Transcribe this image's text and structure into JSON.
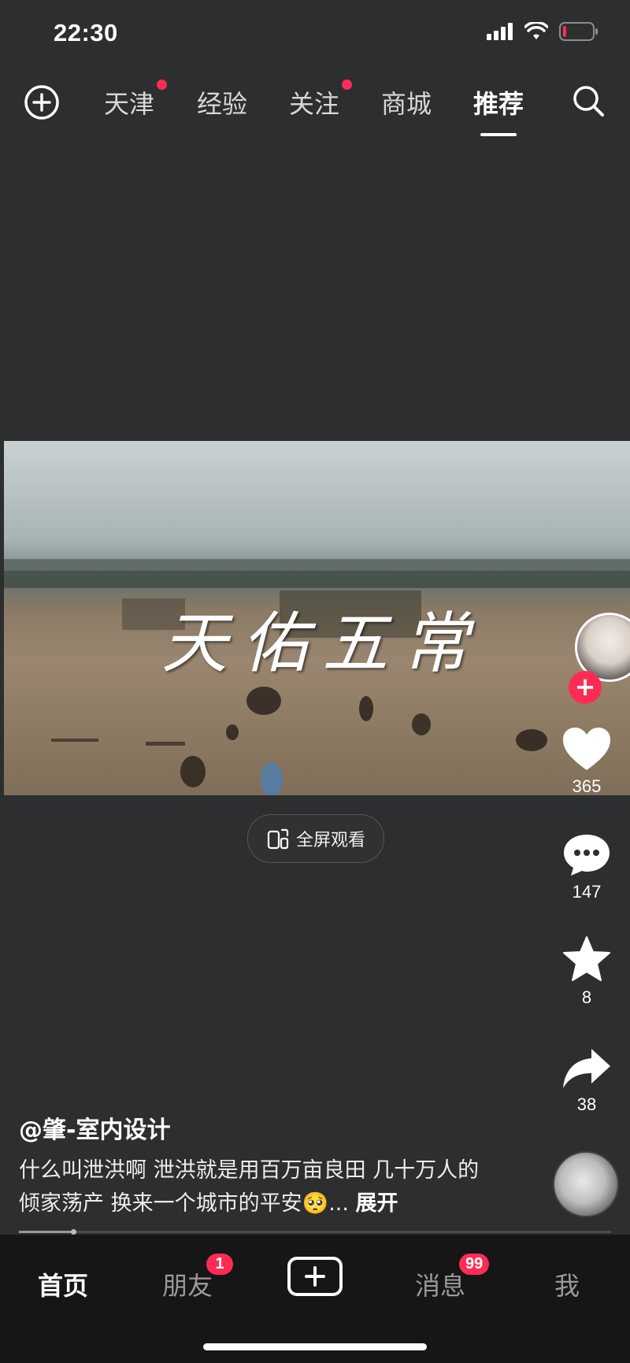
{
  "status_bar": {
    "time": "22:30"
  },
  "top_nav": {
    "tabs": [
      {
        "label": "天津",
        "dot": true
      },
      {
        "label": "经验",
        "dot": false
      },
      {
        "label": "关注",
        "dot": true
      },
      {
        "label": "商城",
        "dot": false
      },
      {
        "label": "推荐",
        "dot": false,
        "active": true
      }
    ]
  },
  "video": {
    "overlay_title": "天佑五常"
  },
  "fullscreen_label": "全屏观看",
  "actions": {
    "likes": "365",
    "comments": "147",
    "favorites": "8",
    "shares": "38"
  },
  "post": {
    "author": "@肇-室内设计",
    "caption": "什么叫泄洪啊 泄洪就是用百万亩良田 几十万人的倾家荡产 换来一个城市的平安🥺...",
    "expand_label": "展开"
  },
  "playback_progress": 0.09,
  "tabbar": {
    "tabs": [
      "首页",
      "朋友",
      "消息",
      "我"
    ],
    "friends_badge": "1",
    "messages_badge": "99"
  },
  "colors": {
    "accent": "#fe2c55",
    "background": "#2c2e2f",
    "tabbar": "#161616"
  }
}
